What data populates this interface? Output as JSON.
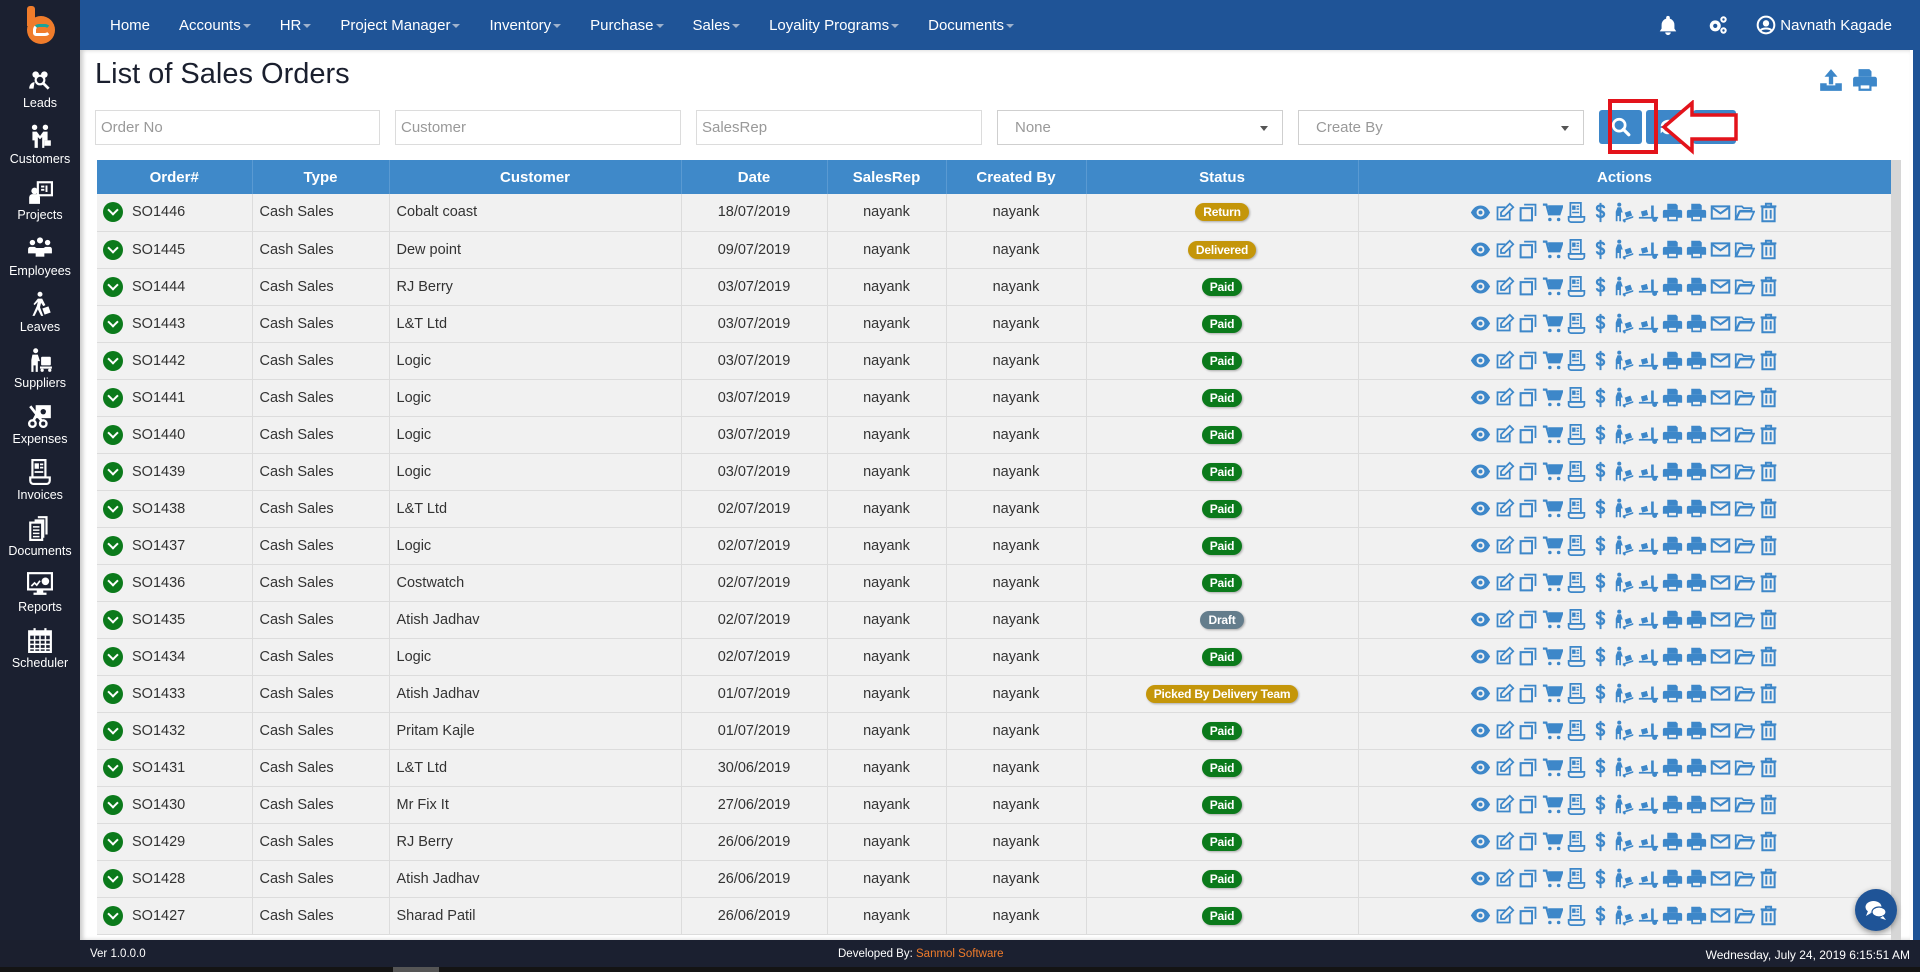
{
  "app": {
    "logo_icon": "app-logo-e"
  },
  "topnav": {
    "items": [
      {
        "label": "Home",
        "dropdown": false
      },
      {
        "label": "Accounts",
        "dropdown": true
      },
      {
        "label": "HR",
        "dropdown": true
      },
      {
        "label": "Project Manager",
        "dropdown": true
      },
      {
        "label": "Inventory",
        "dropdown": true
      },
      {
        "label": "Purchase",
        "dropdown": true
      },
      {
        "label": "Sales",
        "dropdown": true
      },
      {
        "label": "Loyality Programs",
        "dropdown": true
      },
      {
        "label": "Documents",
        "dropdown": true
      }
    ],
    "notifications_icon": "bell-icon",
    "settings_icon": "gears-icon",
    "user_name": "Navnath Kagade"
  },
  "sidebar": {
    "items": [
      {
        "label": "Leads",
        "icon": "leads-icon"
      },
      {
        "label": "Customers",
        "icon": "handshake-icon"
      },
      {
        "label": "Projects",
        "icon": "project-board-icon"
      },
      {
        "label": "Employees",
        "icon": "employees-icon"
      },
      {
        "label": "Leaves",
        "icon": "walking-luggage-icon"
      },
      {
        "label": "Suppliers",
        "icon": "dolly-icon"
      },
      {
        "label": "Expenses",
        "icon": "expense-icon"
      },
      {
        "label": "Invoices",
        "icon": "invoice-icon"
      },
      {
        "label": "Documents",
        "icon": "documents-icon"
      },
      {
        "label": "Reports",
        "icon": "reports-icon"
      },
      {
        "label": "Scheduler",
        "icon": "calendar-icon"
      }
    ]
  },
  "page": {
    "title": "List of Sales Orders",
    "tools": [
      "export-upload-icon",
      "print-icon"
    ]
  },
  "filters": {
    "order_no_placeholder": "Order No",
    "customer_placeholder": "Customer",
    "salesrep_placeholder": "SalesRep",
    "status_select_value": "None",
    "created_by_select_value": "Create By",
    "buttons": [
      "search",
      "refresh",
      "add"
    ]
  },
  "table": {
    "columns": [
      "Order#",
      "Type",
      "Customer",
      "Date",
      "SalesRep",
      "Created By",
      "Status",
      "Actions"
    ],
    "status_colors": {
      "Return": "#c4960a",
      "Delivered": "#c4960a",
      "Paid": "#0b7a1b",
      "Draft": "#647d8c",
      "Picked By Delivery Team": "#c4960a"
    },
    "action_icons": [
      "view-eye-icon",
      "edit-icon",
      "copy-icon",
      "cart-icon",
      "receipt-icon",
      "dollar-icon",
      "dolly-icon",
      "truck-loading-icon",
      "print-icon",
      "print-alt-icon",
      "email-icon",
      "folder-open-icon",
      "trash-icon"
    ],
    "rows": [
      {
        "order": "SO1446",
        "type": "Cash Sales",
        "customer": "Cobalt coast",
        "date": "18/07/2019",
        "salesrep": "nayank",
        "created_by": "nayank",
        "status": "Return"
      },
      {
        "order": "SO1445",
        "type": "Cash Sales",
        "customer": "Dew point",
        "date": "09/07/2019",
        "salesrep": "nayank",
        "created_by": "nayank",
        "status": "Delivered"
      },
      {
        "order": "SO1444",
        "type": "Cash Sales",
        "customer": "RJ Berry",
        "date": "03/07/2019",
        "salesrep": "nayank",
        "created_by": "nayank",
        "status": "Paid"
      },
      {
        "order": "SO1443",
        "type": "Cash Sales",
        "customer": "L&T Ltd",
        "date": "03/07/2019",
        "salesrep": "nayank",
        "created_by": "nayank",
        "status": "Paid"
      },
      {
        "order": "SO1442",
        "type": "Cash Sales",
        "customer": "Logic",
        "date": "03/07/2019",
        "salesrep": "nayank",
        "created_by": "nayank",
        "status": "Paid"
      },
      {
        "order": "SO1441",
        "type": "Cash Sales",
        "customer": "Logic",
        "date": "03/07/2019",
        "salesrep": "nayank",
        "created_by": "nayank",
        "status": "Paid"
      },
      {
        "order": "SO1440",
        "type": "Cash Sales",
        "customer": "Logic",
        "date": "03/07/2019",
        "salesrep": "nayank",
        "created_by": "nayank",
        "status": "Paid"
      },
      {
        "order": "SO1439",
        "type": "Cash Sales",
        "customer": "Logic",
        "date": "03/07/2019",
        "salesrep": "nayank",
        "created_by": "nayank",
        "status": "Paid"
      },
      {
        "order": "SO1438",
        "type": "Cash Sales",
        "customer": "L&T Ltd",
        "date": "02/07/2019",
        "salesrep": "nayank",
        "created_by": "nayank",
        "status": "Paid"
      },
      {
        "order": "SO1437",
        "type": "Cash Sales",
        "customer": "Logic",
        "date": "02/07/2019",
        "salesrep": "nayank",
        "created_by": "nayank",
        "status": "Paid"
      },
      {
        "order": "SO1436",
        "type": "Cash Sales",
        "customer": "Costwatch",
        "date": "02/07/2019",
        "salesrep": "nayank",
        "created_by": "nayank",
        "status": "Paid"
      },
      {
        "order": "SO1435",
        "type": "Cash Sales",
        "customer": "Atish Jadhav",
        "date": "02/07/2019",
        "salesrep": "nayank",
        "created_by": "nayank",
        "status": "Draft"
      },
      {
        "order": "SO1434",
        "type": "Cash Sales",
        "customer": "Logic",
        "date": "02/07/2019",
        "salesrep": "nayank",
        "created_by": "nayank",
        "status": "Paid"
      },
      {
        "order": "SO1433",
        "type": "Cash Sales",
        "customer": "Atish Jadhav",
        "date": "01/07/2019",
        "salesrep": "nayank",
        "created_by": "nayank",
        "status": "Picked By Delivery Team"
      },
      {
        "order": "SO1432",
        "type": "Cash Sales",
        "customer": "Pritam Kajle",
        "date": "01/07/2019",
        "salesrep": "nayank",
        "created_by": "nayank",
        "status": "Paid"
      },
      {
        "order": "SO1431",
        "type": "Cash Sales",
        "customer": "L&T Ltd",
        "date": "30/06/2019",
        "salesrep": "nayank",
        "created_by": "nayank",
        "status": "Paid"
      },
      {
        "order": "SO1430",
        "type": "Cash Sales",
        "customer": "Mr Fix It",
        "date": "27/06/2019",
        "salesrep": "nayank",
        "created_by": "nayank",
        "status": "Paid"
      },
      {
        "order": "SO1429",
        "type": "Cash Sales",
        "customer": "RJ Berry",
        "date": "26/06/2019",
        "salesrep": "nayank",
        "created_by": "nayank",
        "status": "Paid"
      },
      {
        "order": "SO1428",
        "type": "Cash Sales",
        "customer": "Atish Jadhav",
        "date": "26/06/2019",
        "salesrep": "nayank",
        "created_by": "nayank",
        "status": "Paid"
      },
      {
        "order": "SO1427",
        "type": "Cash Sales",
        "customer": "Sharad Patil",
        "date": "26/06/2019",
        "salesrep": "nayank",
        "created_by": "nayank",
        "status": "Paid"
      }
    ]
  },
  "footer": {
    "version": "Ver 1.0.0.0",
    "developed_by_label": "Developed By: ",
    "developer": "Sanmol Software",
    "datetime": "Wednesday, July 24, 2019 6:15:51 AM"
  },
  "colors": {
    "nav_bg": "#1f5497",
    "sidebar_bg": "#1b2030",
    "accent": "#3d87c9",
    "brand_orange": "#f07c2b",
    "highlight_red": "#e3131b"
  }
}
